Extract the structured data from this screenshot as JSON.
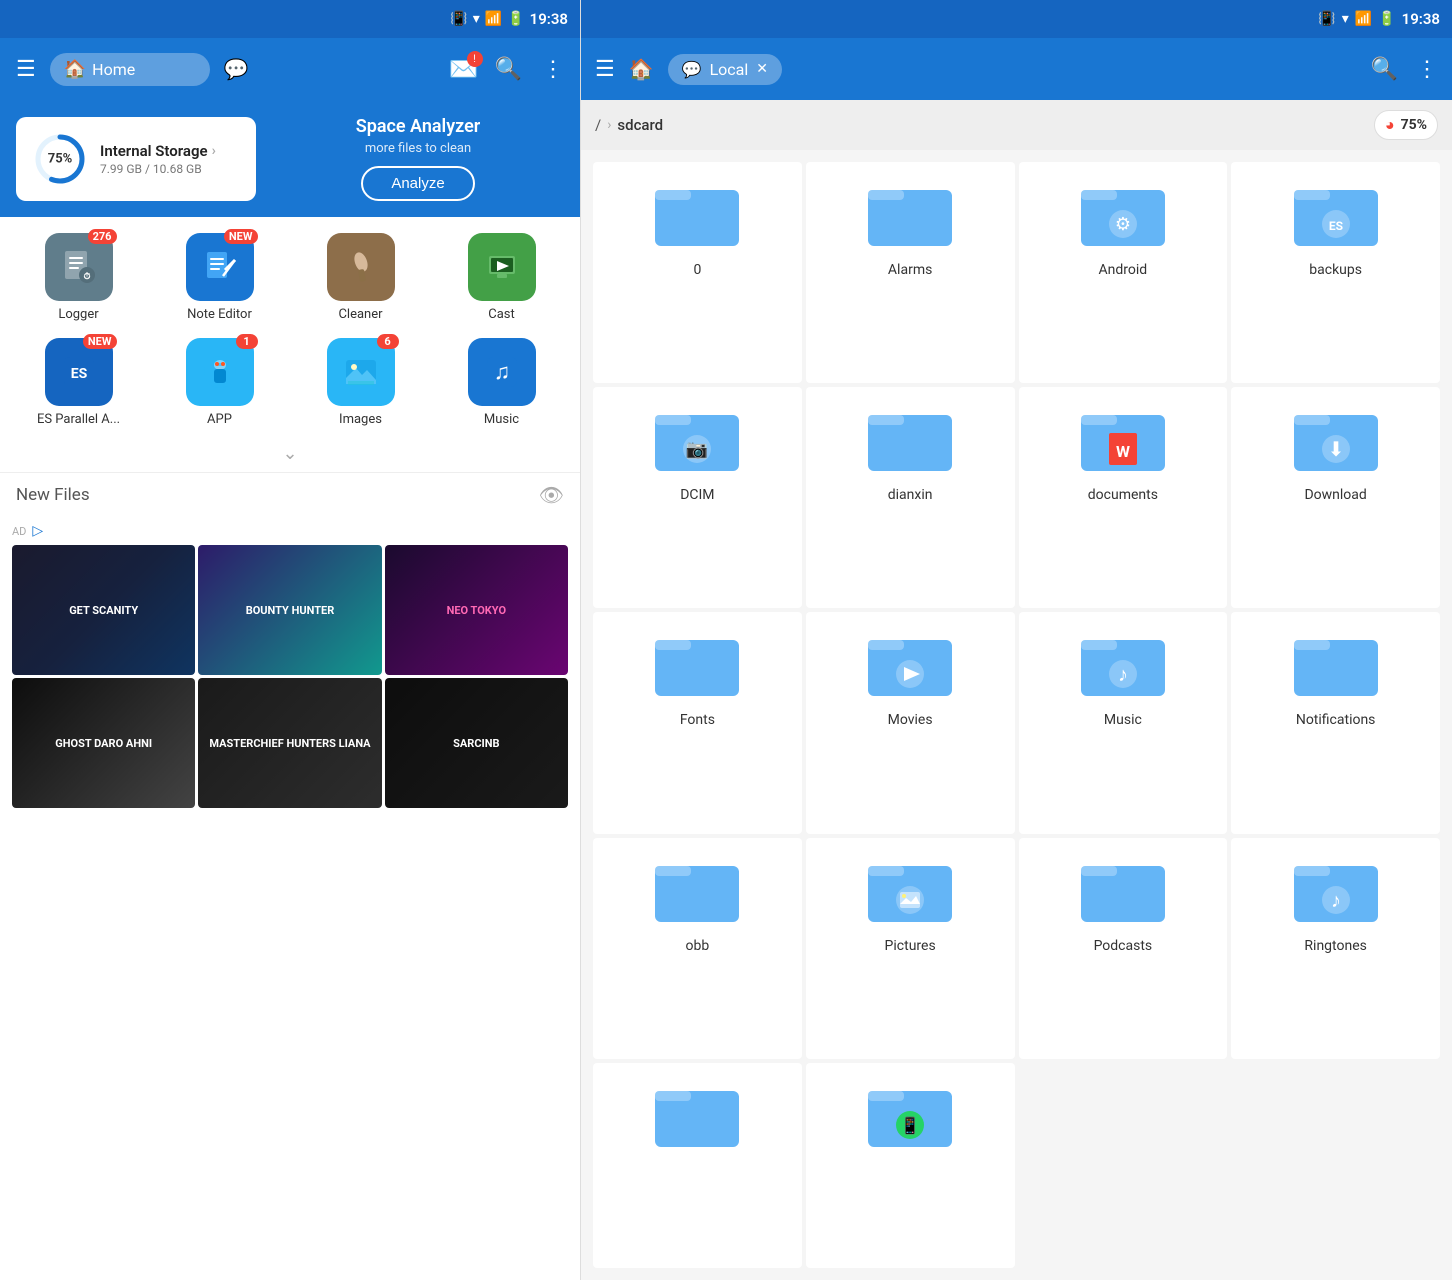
{
  "left": {
    "status": {
      "time": "19:38"
    },
    "topbar": {
      "home_label": "Home"
    },
    "storage": {
      "percent": 75,
      "title": "Internal Storage",
      "subtitle": "7.99 GB / 10.68 GB",
      "analyzer_title": "Space Analyzer",
      "analyzer_sub": "more files to clean",
      "analyze_btn": "Analyze"
    },
    "apps": [
      {
        "id": "logger",
        "label": "Logger",
        "badge": "276",
        "badge_type": "number",
        "color": "#607D8B",
        "icon": "📋"
      },
      {
        "id": "note-editor",
        "label": "Note Editor",
        "badge": "NEW",
        "badge_type": "new",
        "color": "#1976D2",
        "icon": "📝"
      },
      {
        "id": "cleaner",
        "label": "Cleaner",
        "badge": "",
        "badge_type": "",
        "color": "#8D6E4A",
        "icon": "🧹"
      },
      {
        "id": "cast",
        "label": "Cast",
        "badge": "",
        "badge_type": "",
        "color": "#43A047",
        "icon": "📺"
      },
      {
        "id": "es-parallel",
        "label": "ES Parallel A...",
        "badge": "NEW",
        "badge_type": "new",
        "color": "#1565C0",
        "icon": "📦"
      },
      {
        "id": "app",
        "label": "APP",
        "badge": "1",
        "badge_type": "number",
        "color": "#29B6F6",
        "icon": "🤖"
      },
      {
        "id": "images",
        "label": "Images",
        "badge": "6",
        "badge_type": "number",
        "color": "#29B6F6",
        "icon": "🖼"
      },
      {
        "id": "music",
        "label": "Music",
        "badge": "",
        "badge_type": "",
        "color": "#1976D2",
        "icon": "🎵"
      }
    ],
    "new_files_title": "New Files",
    "ad_label": "AD"
  },
  "right": {
    "status": {
      "time": "19:38"
    },
    "topbar": {
      "local_label": "Local"
    },
    "breadcrumb": {
      "root": "/",
      "current": "sdcard",
      "usage": "75%"
    },
    "folders": [
      {
        "id": "zero",
        "name": "0",
        "icon": ""
      },
      {
        "id": "alarms",
        "name": "Alarms",
        "icon": ""
      },
      {
        "id": "android",
        "name": "Android",
        "icon": "⚙"
      },
      {
        "id": "backups",
        "name": "backups",
        "icon": "ES"
      },
      {
        "id": "dcim",
        "name": "DCIM",
        "icon": "📷"
      },
      {
        "id": "dianxin",
        "name": "dianxin",
        "icon": ""
      },
      {
        "id": "documents",
        "name": "documents",
        "icon": "W"
      },
      {
        "id": "download",
        "name": "Download",
        "icon": "⬇"
      },
      {
        "id": "fonts",
        "name": "Fonts",
        "icon": ""
      },
      {
        "id": "movies",
        "name": "Movies",
        "icon": "▶"
      },
      {
        "id": "music",
        "name": "Music",
        "icon": "♪"
      },
      {
        "id": "notifications",
        "name": "Notifications",
        "icon": ""
      },
      {
        "id": "obb",
        "name": "obb",
        "icon": ""
      },
      {
        "id": "pictures",
        "name": "Pictures",
        "icon": "🖼"
      },
      {
        "id": "podcasts",
        "name": "Podcasts",
        "icon": ""
      },
      {
        "id": "ringtones",
        "name": "Ringtones",
        "icon": "♪"
      },
      {
        "id": "folder17",
        "name": "",
        "icon": ""
      },
      {
        "id": "folder18",
        "name": "",
        "icon": "📱"
      }
    ]
  }
}
